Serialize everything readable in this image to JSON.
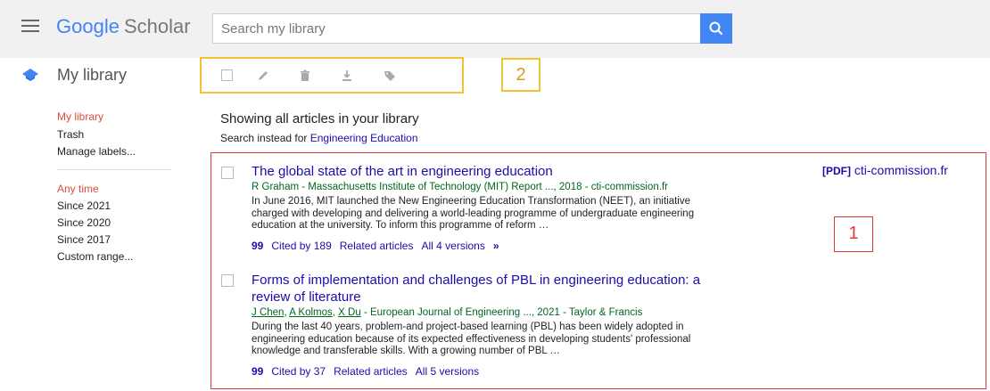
{
  "header": {
    "logo_google": "Google",
    "logo_scholar": "Scholar",
    "search_placeholder": "Search my library"
  },
  "subheader": {
    "title": "My library",
    "callout_2": "2"
  },
  "sidebar": {
    "items": [
      "My library",
      "Trash",
      "Manage labels..."
    ],
    "time_filters": [
      "Any time",
      "Since 2021",
      "Since 2020",
      "Since 2017",
      "Custom range..."
    ]
  },
  "main": {
    "showing": "Showing all articles in your library",
    "search_instead_prefix": "Search instead for",
    "search_instead_query": "Engineering Education",
    "callout_1": "1",
    "results": [
      {
        "title": "The global state of the art in engineering education",
        "authors": "R Graham - Massachusetts Institute of Technology (MIT) Report ..., 2018 - cti-commission.fr",
        "snippet": "In June 2016, MIT launched the New Engineering Education Transformation (NEET), an initiative charged with developing and delivering a world-leading programme of undergraduate engineering education at the university. To inform this programme of reform …",
        "cited": "Cited by 189",
        "related": "Related articles",
        "versions": "All 4 versions",
        "pdf_tag": "[PDF]",
        "pdf_source": "cti-commission.fr"
      },
      {
        "title_line1": "Forms of implementation and challenges of PBL in engineering education: a",
        "title_line2": "review of literature",
        "author1": "J Chen",
        "author2": "A Kolmos",
        "author3": "X Du",
        "authors_rest": " - European Journal of Engineering ..., 2021 - Taylor & Francis",
        "snippet": "During the last 40 years, problem-and project-based learning (PBL) has been widely adopted in engineering education because of its expected effectiveness in developing students' professional knowledge and transferable skills. With a growing number of PBL …",
        "cited": "Cited by 37",
        "related": "Related articles",
        "versions": "All 5 versions"
      }
    ]
  },
  "colors": {
    "accent_blue": "#4285f4",
    "link": "#1a0dab",
    "author_green": "#006621",
    "active_red": "#dd4b39",
    "callout_red": "#e53935",
    "callout_yellow": "#f1c232"
  },
  "icons": [
    "menu-icon",
    "search-icon",
    "library-icon",
    "edit-icon",
    "delete-icon",
    "export-icon",
    "label-icon",
    "quote-icon",
    "more-icon"
  ]
}
